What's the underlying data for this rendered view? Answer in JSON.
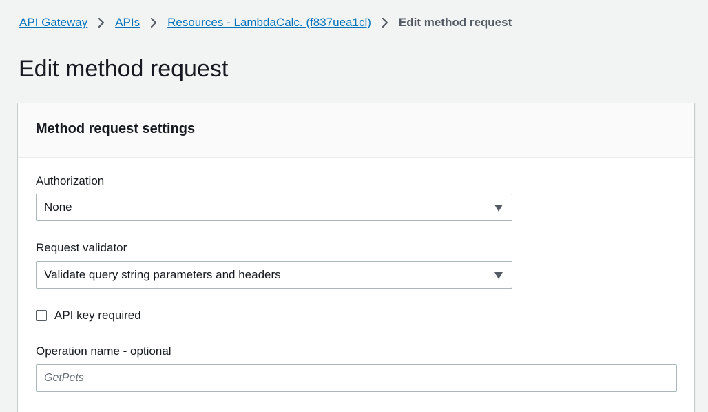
{
  "breadcrumb": {
    "items": [
      {
        "label": "API Gateway"
      },
      {
        "label": "APIs"
      },
      {
        "label": "Resources - LambdaCalc. (f837uea1cl)"
      }
    ],
    "current": "Edit method request"
  },
  "page": {
    "title": "Edit method request"
  },
  "panel": {
    "title": "Method request settings",
    "authorization": {
      "label": "Authorization",
      "value": "None"
    },
    "request_validator": {
      "label": "Request validator",
      "value": "Validate query string parameters and headers"
    },
    "api_key": {
      "label": "API key required",
      "checked": false
    },
    "operation_name": {
      "label": "Operation name - optional",
      "placeholder": "GetPets",
      "value": ""
    }
  },
  "colors": {
    "link": "#0073bb",
    "background": "#f2f3f3",
    "panel_header": "#fafafa",
    "border": "#aab7b8",
    "text": "#16191f",
    "muted": "#545b64"
  },
  "icons": {
    "breadcrumb_separator": "chevron-right-icon",
    "select_caret": "caret-down-icon"
  }
}
